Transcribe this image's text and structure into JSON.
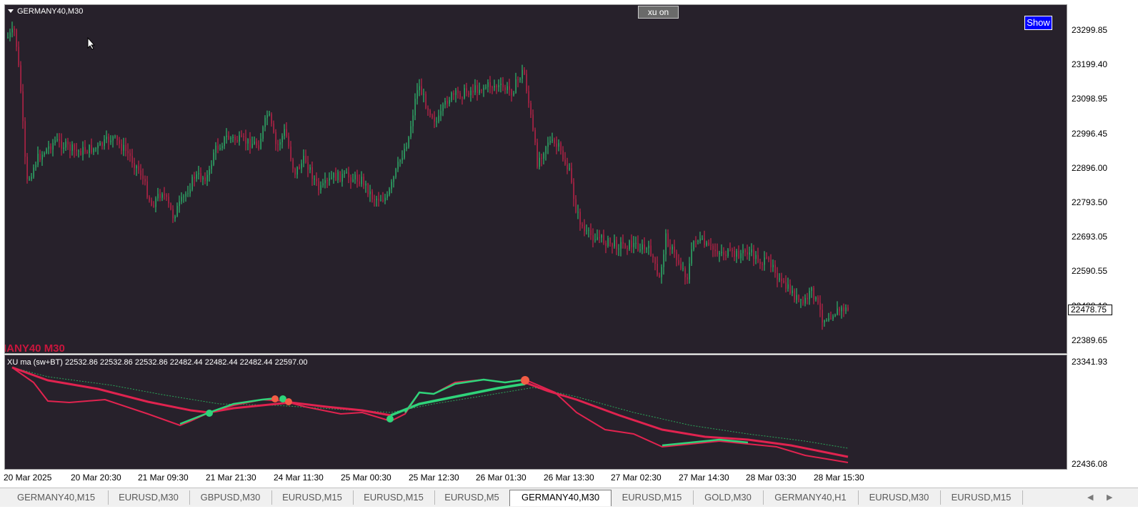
{
  "chart": {
    "title": "GERMANY40,M30",
    "button_xu": "xu on",
    "button_show": "Show",
    "watermark": "IANY40 M30",
    "price_scale": [
      "23299.85",
      "23199.40",
      "23098.95",
      "22996.45",
      "22896.00",
      "22793.50",
      "22693.05",
      "22590.55",
      "22488.10",
      "22389.65"
    ],
    "current_price": "22478.75",
    "bull_color": "#2fd47a",
    "bear_color": "#e0234f",
    "background": "#27212b"
  },
  "indicator": {
    "title": "XU ma (sw+BT) 22532.86 22532.86 22532.86 22482.44 22482.44 22482.44 22597.00",
    "scale_top": "23341.93",
    "scale_bottom": "22436.08"
  },
  "time_axis": [
    "20 Mar 2025",
    "20 Mar 20:30",
    "21 Mar 09:30",
    "21 Mar 21:30",
    "24 Mar 11:30",
    "25 Mar 00:30",
    "25 Mar 12:30",
    "26 Mar 01:30",
    "26 Mar 13:30",
    "27 Mar 02:30",
    "27 Mar 14:30",
    "28 Mar 03:30",
    "28 Mar 15:30"
  ],
  "tabs": [
    "GERMANY40,M15",
    "EURUSD,M30",
    "GBPUSD,M30",
    "EURUSD,M15",
    "EURUSD,M15",
    "EURUSD,M5",
    "GERMANY40,M30",
    "EURUSD,M15",
    "GOLD,M30",
    "GERMANY40,H1",
    "EURUSD,M30",
    "EURUSD,M15"
  ],
  "active_tab": 6
}
